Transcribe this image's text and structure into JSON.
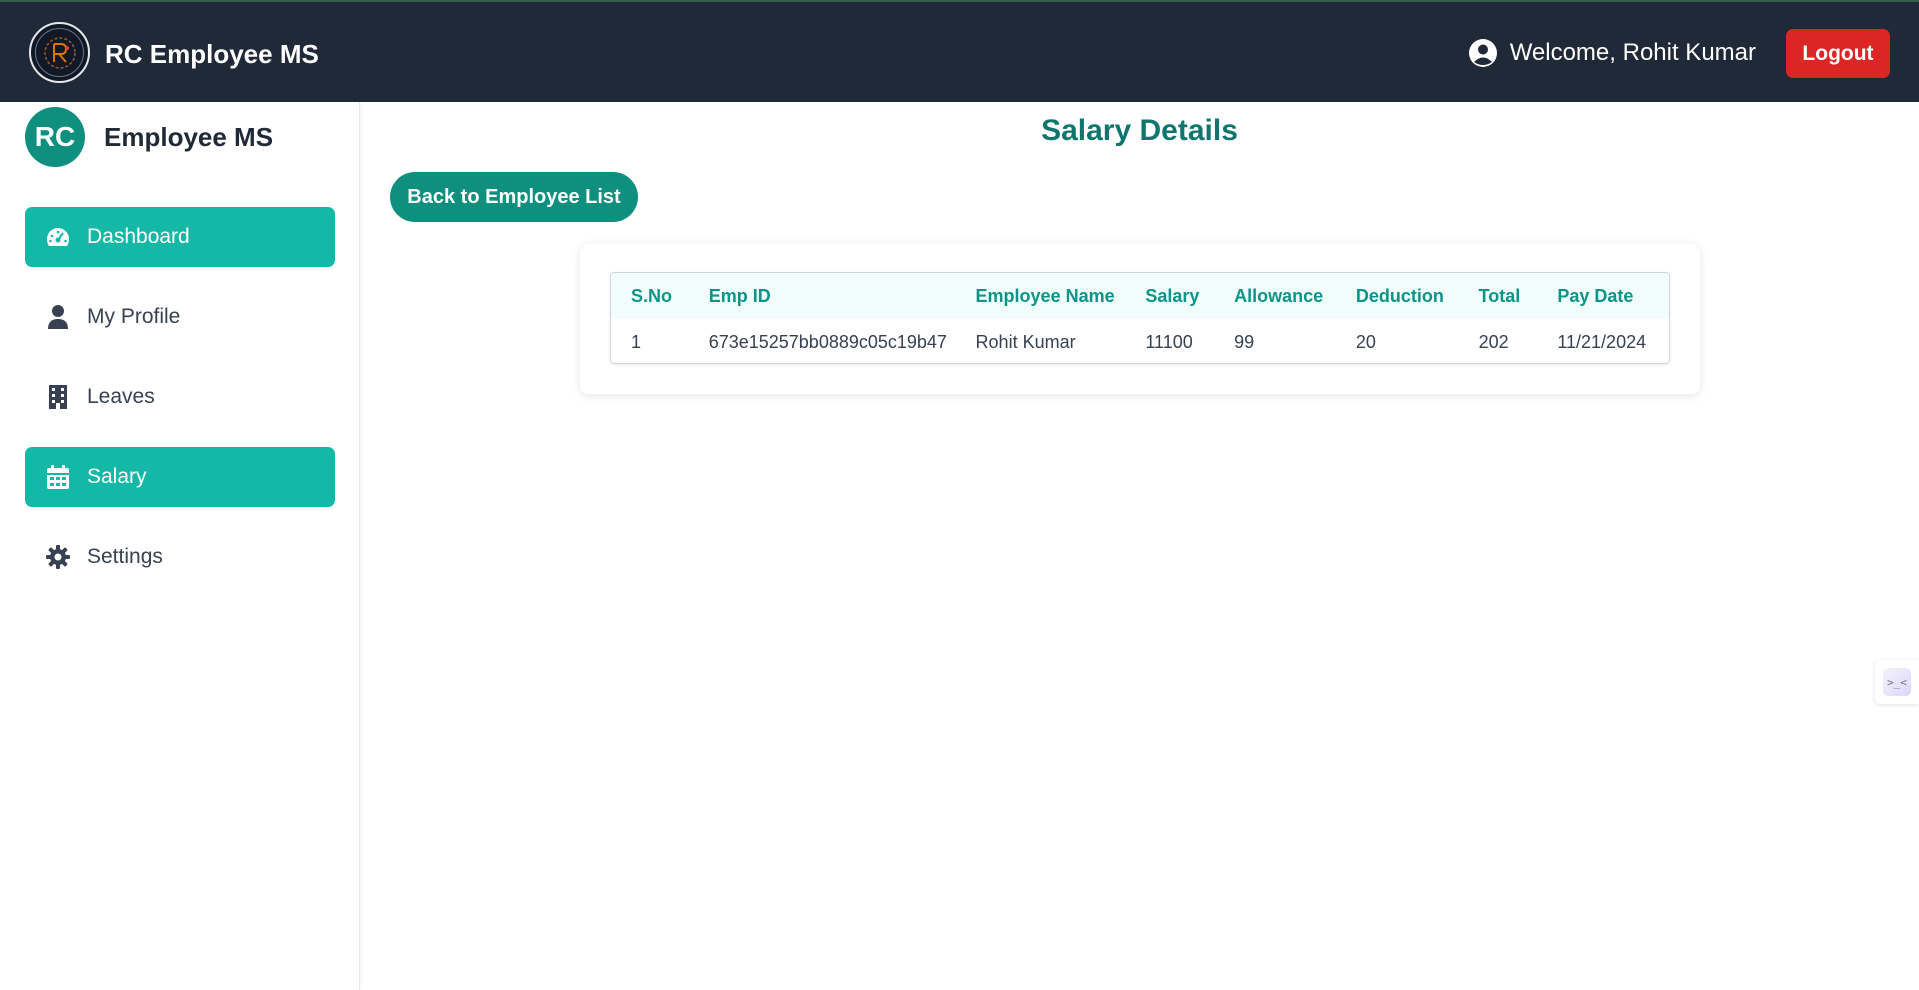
{
  "header": {
    "brand_title": "RC Employee MS",
    "welcome_text": "Welcome, Rohit Kumar",
    "logout_label": "Logout"
  },
  "sidebar": {
    "avatar_initials": "RC",
    "brand_title": "Employee MS",
    "items": [
      {
        "label": "Dashboard",
        "icon": "gauge-icon",
        "active": true
      },
      {
        "label": "My Profile",
        "icon": "user-icon",
        "active": false
      },
      {
        "label": "Leaves",
        "icon": "building-icon",
        "active": false
      },
      {
        "label": "Salary",
        "icon": "calendar-icon",
        "active": true
      },
      {
        "label": "Settings",
        "icon": "gear-icon",
        "active": false
      }
    ]
  },
  "main": {
    "title": "Salary Details",
    "back_button_label": "Back to Employee List",
    "table": {
      "columns": [
        "S.No",
        "Emp ID",
        "Employee Name",
        "Salary",
        "Allowance",
        "Deduction",
        "Total",
        "Pay Date"
      ],
      "rows": [
        [
          "1",
          "673e15257bb0889c05c19b47",
          "Rohit Kumar",
          "11100",
          "99",
          "20",
          "202",
          "11/21/2024"
        ]
      ]
    }
  },
  "floating_widget": {
    "glyph": ">_<"
  },
  "colors": {
    "navbar": "#1f2937",
    "accent": "#14b8a6",
    "accent_dark": "#0f8f7e",
    "title": "#0f766e",
    "logout": "#dc2626"
  }
}
